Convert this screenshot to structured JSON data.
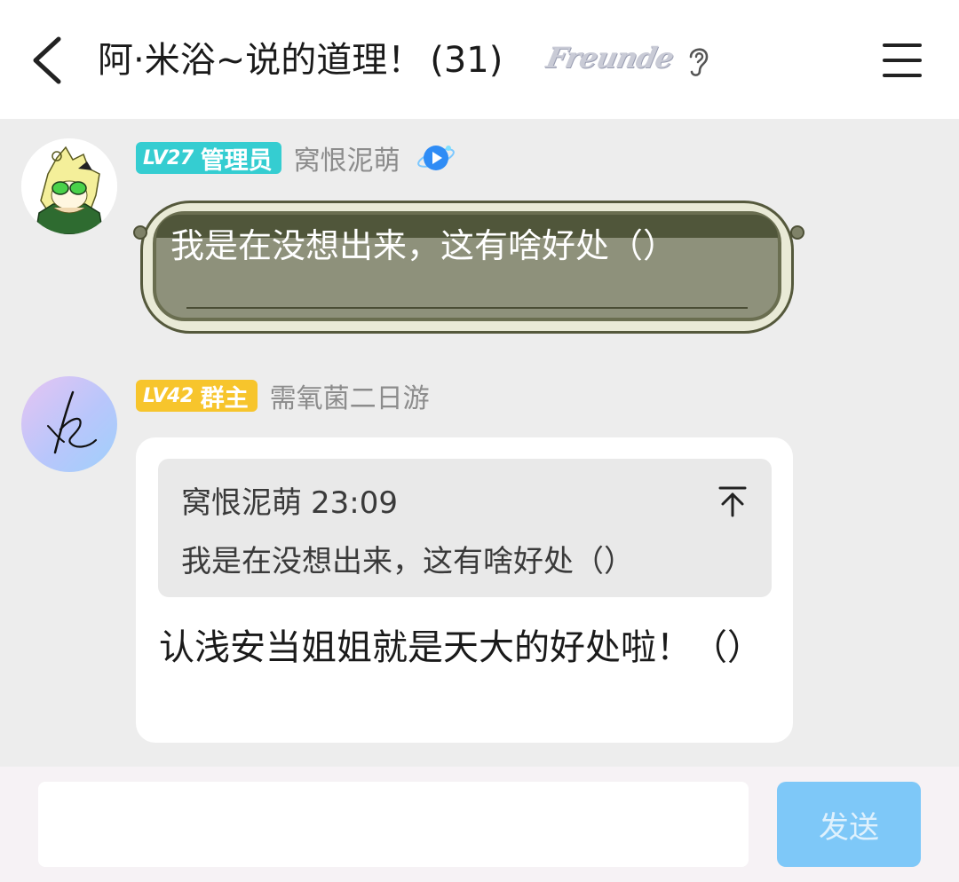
{
  "header": {
    "title": "阿·米浴~说的道理！",
    "member_count": "(31)",
    "group_badge": "Freunde",
    "icons": {
      "back": "chevron-left-icon",
      "listen": "ear-icon",
      "menu": "hamburger-menu-icon"
    }
  },
  "messages": [
    {
      "level": "LV27",
      "role": "管理员",
      "sender": "窝恨泥萌",
      "role_color": "#35cdd1",
      "vip_icon": "play-planet-icon",
      "text": "我是在没想出来，这有啥好处（）"
    },
    {
      "level": "LV42",
      "role": "群主",
      "sender": "需氧菌二日游",
      "role_color": "#f7c52c",
      "quote": {
        "sender": "窝恨泥萌",
        "time": "23:09",
        "text": "我是在没想出来，这有啥好处（）",
        "icon": "jump-to-top-icon"
      },
      "text": "认浅安当姐姐就是天大的好处啦！（）"
    }
  ],
  "composer": {
    "input_value": "",
    "send_label": "发送",
    "send_color": "#7ec8f8"
  }
}
